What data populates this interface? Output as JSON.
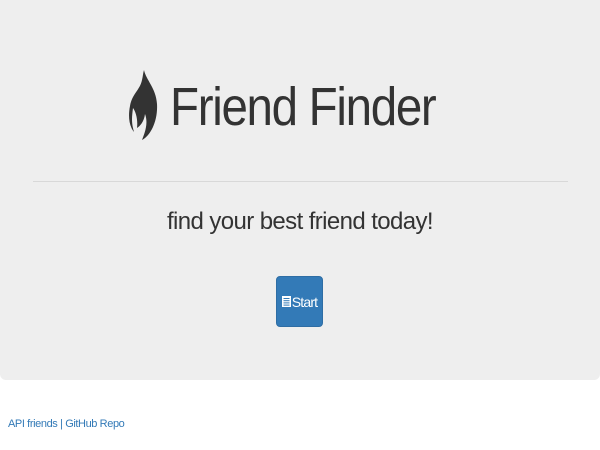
{
  "header": {
    "title": "Friend Finder",
    "icon": "fire-icon",
    "subtitle": "find your best friend today!"
  },
  "start_button": {
    "icon": "list-icon",
    "label": "Start"
  },
  "footer": {
    "links": [
      {
        "label": "API friends"
      },
      {
        "label": "GitHub Repo"
      }
    ],
    "separator": "|"
  },
  "colors": {
    "jumbotron_bg": "#eeeeee",
    "primary": "#337ab7",
    "text": "#333333"
  }
}
